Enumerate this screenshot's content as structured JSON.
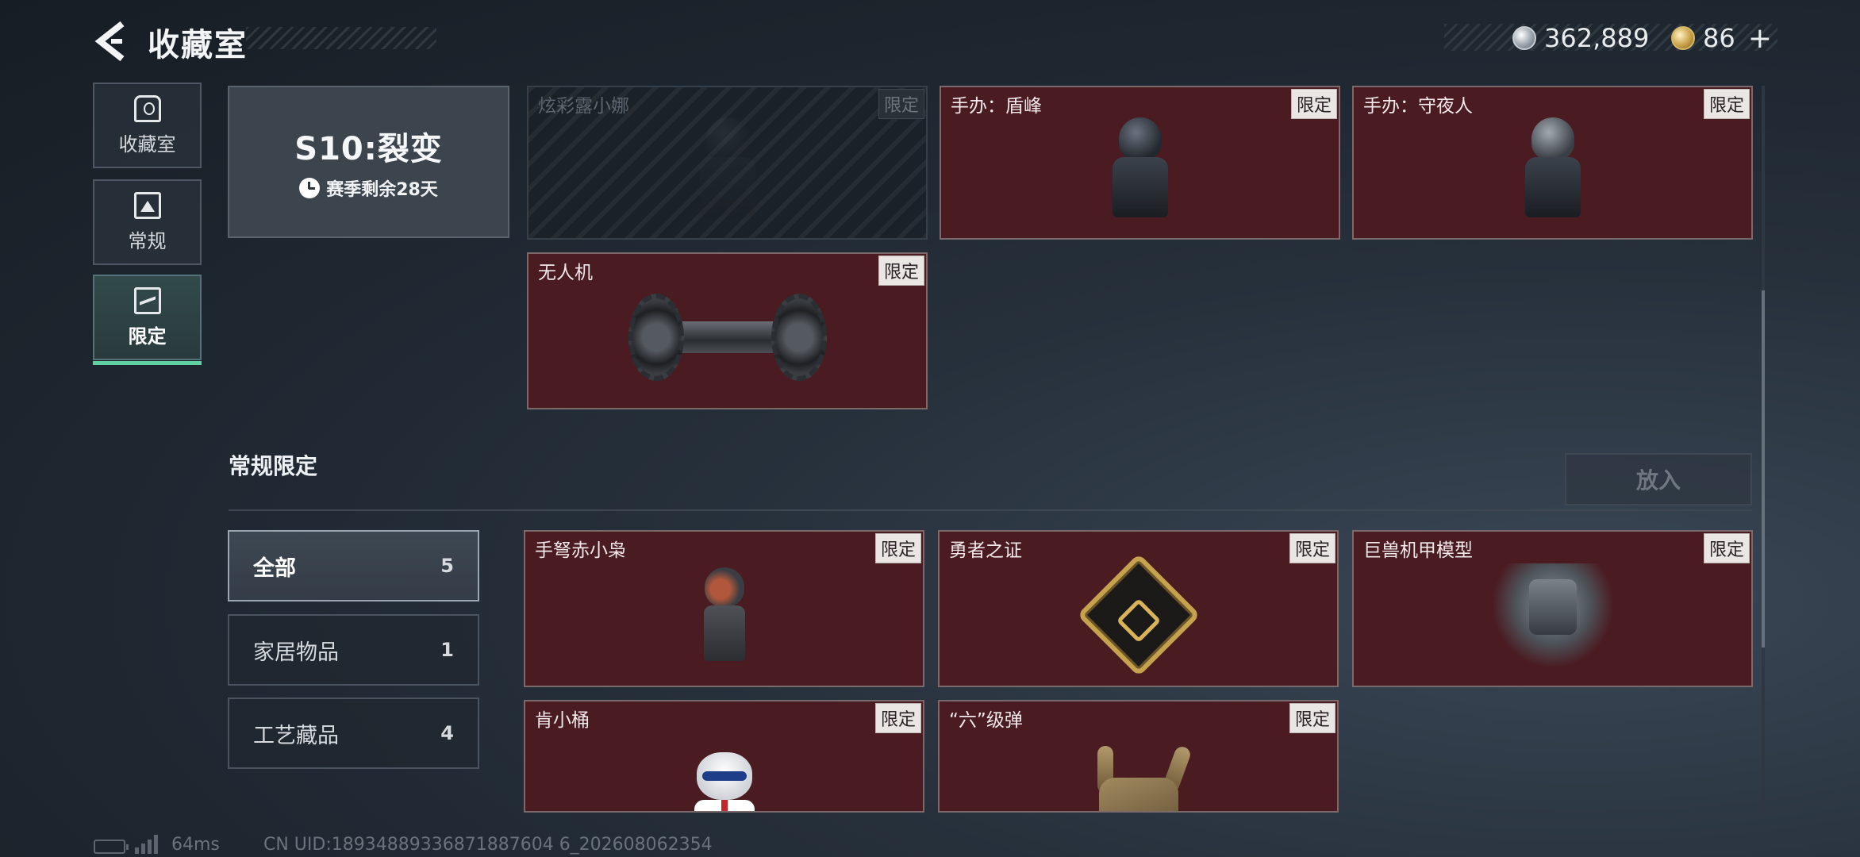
{
  "header": {
    "title": "收藏室",
    "currencies": [
      {
        "icon": "silver-coin-icon",
        "value": "362,889"
      },
      {
        "icon": "gold-coin-icon",
        "value": "86"
      }
    ],
    "add_label": "+"
  },
  "sidebar": {
    "items": [
      {
        "label": "收藏室",
        "icon": "collection-icon",
        "active": false
      },
      {
        "label": "常规",
        "icon": "normal-icon",
        "active": false
      },
      {
        "label": "限定",
        "icon": "limited-icon",
        "active": true
      }
    ]
  },
  "season": {
    "title": "S10:裂变",
    "remaining": "赛季剩余28天"
  },
  "season_items": [
    {
      "name": "炫彩露小娜",
      "badge": "限定",
      "faded": true
    },
    {
      "name": "手办：盾峰",
      "badge": "限定"
    },
    {
      "name": "手办：守夜人",
      "badge": "限定"
    },
    {
      "name": "无人机",
      "badge": "限定"
    }
  ],
  "regular": {
    "title": "常规限定",
    "put_label": "放入",
    "filters": [
      {
        "label": "全部",
        "count": "5",
        "active": true
      },
      {
        "label": "家居物品",
        "count": "1"
      },
      {
        "label": "工艺藏品",
        "count": "4"
      }
    ],
    "items": [
      {
        "name": "手弩赤小枭",
        "badge": "限定"
      },
      {
        "name": "勇者之证",
        "badge": "限定"
      },
      {
        "name": "巨兽机甲模型",
        "badge": "限定"
      },
      {
        "name": "肯小桶",
        "badge": "限定"
      },
      {
        "name": "“六”级弹",
        "badge": "限定"
      }
    ]
  },
  "footer": {
    "ping": "64ms",
    "uid": "CN UID:18934889336871887604 6_202608062354"
  },
  "colors": {
    "accent": "#5fd1a2",
    "card_bg": "#4a1c22",
    "badge_bg": "#e9e6e3"
  }
}
